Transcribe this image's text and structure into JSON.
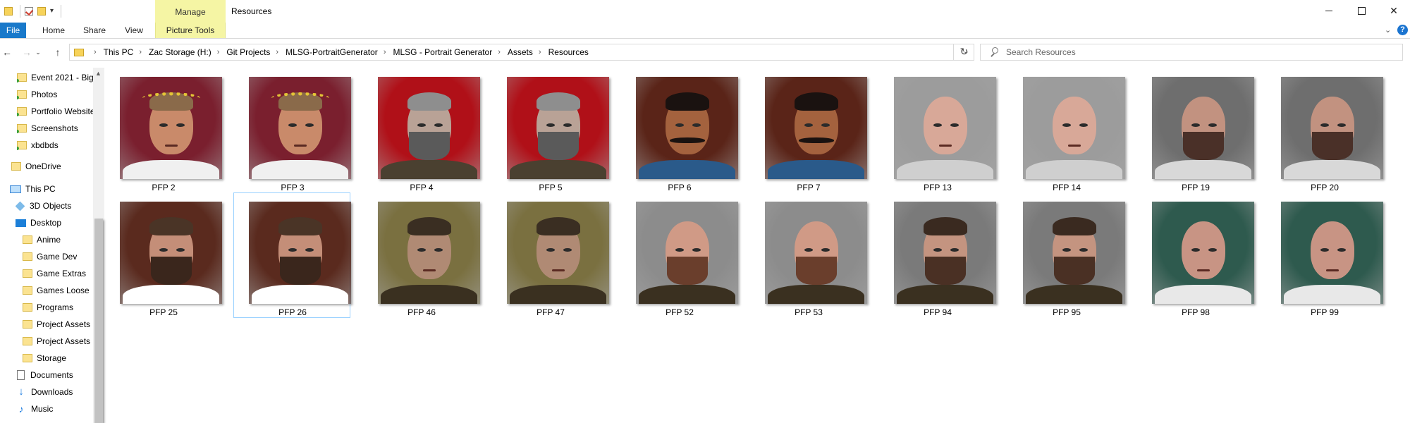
{
  "window": {
    "title": "Resources",
    "context_tab_group": "Manage"
  },
  "ribbon": {
    "tabs": [
      "File",
      "Home",
      "Share",
      "View",
      "Picture Tools"
    ]
  },
  "address": {
    "breadcrumbs": [
      "This PC",
      "Zac Storage (H:)",
      "Git Projects",
      "MLSG-PortraitGenerator",
      "MLSG - Portrait Generator",
      "Assets",
      "Resources"
    ]
  },
  "search": {
    "placeholder": "Search Resources"
  },
  "sidebar": {
    "items": [
      {
        "label": "Event 2021 - Big",
        "icon": "folder-synced-icon"
      },
      {
        "label": "Photos",
        "icon": "folder-synced-icon"
      },
      {
        "label": "Portfolio Website",
        "icon": "folder-synced-icon"
      },
      {
        "label": "Screenshots",
        "icon": "folder-synced-icon"
      },
      {
        "label": "xbdbds",
        "icon": "folder-synced-icon"
      },
      {
        "label": "OneDrive",
        "icon": "folder-icon"
      },
      {
        "label": "This PC",
        "icon": "computer-icon"
      },
      {
        "label": "3D Objects",
        "icon": "cube-icon"
      },
      {
        "label": "Desktop",
        "icon": "desktop-icon"
      },
      {
        "label": "Anime",
        "icon": "folder-icon"
      },
      {
        "label": "Game Dev",
        "icon": "folder-icon"
      },
      {
        "label": "Game Extras",
        "icon": "folder-icon"
      },
      {
        "label": "Games Loose",
        "icon": "folder-icon"
      },
      {
        "label": "Programs",
        "icon": "folder-icon"
      },
      {
        "label": "Project Assets (",
        "icon": "folder-icon"
      },
      {
        "label": "Project Assets (",
        "icon": "folder-icon"
      },
      {
        "label": "Storage",
        "icon": "folder-icon"
      },
      {
        "label": "Documents",
        "icon": "documents-icon"
      },
      {
        "label": "Downloads",
        "icon": "downloads-icon"
      },
      {
        "label": "Music",
        "icon": "music-icon"
      }
    ]
  },
  "files": [
    {
      "name": "PFP 2",
      "bg": "#7a1f2e",
      "skin": "#c98a6a",
      "hair": "#8a6a4a",
      "beard": "",
      "robe": "#f0f0f0",
      "extra": "wreath"
    },
    {
      "name": "PFP 3",
      "bg": "#7a1f2e",
      "skin": "#c98a6a",
      "hair": "#8a6a4a",
      "beard": "",
      "robe": "#f0f0f0",
      "extra": "wreath"
    },
    {
      "name": "PFP 4",
      "bg": "#b01018",
      "skin": "#b9a296",
      "hair": "#8e8e8e",
      "beard": "#5a5a5a",
      "robe": "#4a4030",
      "extra": ""
    },
    {
      "name": "PFP 5",
      "bg": "#b01018",
      "skin": "#b9a296",
      "hair": "#8e8e8e",
      "beard": "#5a5a5a",
      "robe": "#4a4030",
      "extra": ""
    },
    {
      "name": "PFP 6",
      "bg": "#5a2418",
      "skin": "#a4623e",
      "hair": "#1a1210",
      "beard": "",
      "robe": "#2a5a8a",
      "extra": "mustache"
    },
    {
      "name": "PFP 7",
      "bg": "#5a2418",
      "skin": "#a4623e",
      "hair": "#1a1210",
      "beard": "",
      "robe": "#2a5a8a",
      "extra": "mustache"
    },
    {
      "name": "PFP 13",
      "bg": "#9c9c9c",
      "skin": "#d8a898",
      "hair": "",
      "beard": "",
      "robe": "#cfcfcf",
      "extra": ""
    },
    {
      "name": "PFP 14",
      "bg": "#9c9c9c",
      "skin": "#d8a898",
      "hair": "",
      "beard": "",
      "robe": "#cfcfcf",
      "extra": ""
    },
    {
      "name": "PFP 19",
      "bg": "#6e6e6e",
      "skin": "#c29280",
      "hair": "",
      "beard": "#4a3028",
      "robe": "#d8d8d8",
      "extra": ""
    },
    {
      "name": "PFP 20",
      "bg": "#6e6e6e",
      "skin": "#c29280",
      "hair": "",
      "beard": "#4a3028",
      "robe": "#d8d8d8",
      "extra": ""
    },
    {
      "name": "PFP 25",
      "bg": "#5a2a1e",
      "skin": "#c48e78",
      "hair": "#4a3426",
      "beard": "#3a261c",
      "robe": "#ffffff",
      "extra": ""
    },
    {
      "name": "PFP 26",
      "bg": "#5a2a1e",
      "skin": "#c48e78",
      "hair": "#4a3426",
      "beard": "#3a261c",
      "robe": "#ffffff",
      "extra": ""
    },
    {
      "name": "PFP 46",
      "bg": "#7a7040",
      "skin": "#b08a74",
      "hair": "#3a2e22",
      "beard": "",
      "robe": "#3a3020",
      "extra": ""
    },
    {
      "name": "PFP 47",
      "bg": "#7a7040",
      "skin": "#b08a74",
      "hair": "#3a2e22",
      "beard": "",
      "robe": "#3a3020",
      "extra": ""
    },
    {
      "name": "PFP 52",
      "bg": "#8c8c8c",
      "skin": "#d09a86",
      "hair": "",
      "beard": "#6a3e2c",
      "robe": "#3a3020",
      "extra": ""
    },
    {
      "name": "PFP 53",
      "bg": "#8c8c8c",
      "skin": "#d09a86",
      "hair": "",
      "beard": "#6a3e2c",
      "robe": "#3a3020",
      "extra": ""
    },
    {
      "name": "PFP 94",
      "bg": "#7a7a7a",
      "skin": "#c49480",
      "hair": "#3a2a20",
      "beard": "#4a3024",
      "robe": "#3a3020",
      "extra": ""
    },
    {
      "name": "PFP 95",
      "bg": "#7a7a7a",
      "skin": "#c49480",
      "hair": "#3a2a20",
      "beard": "#4a3024",
      "robe": "#3a3020",
      "extra": ""
    },
    {
      "name": "PFP 98",
      "bg": "#2e5a4e",
      "skin": "#c89484",
      "hair": "",
      "beard": "",
      "robe": "#e8e8e8",
      "extra": ""
    },
    {
      "name": "PFP 99",
      "bg": "#2e5a4e",
      "skin": "#c89484",
      "hair": "",
      "beard": "",
      "robe": "#e8e8e8",
      "extra": ""
    }
  ],
  "selected_file": "PFP 26",
  "colors": {
    "accent": "#1979ca",
    "picture_tools": "#f5f5a4",
    "selection_border": "#99d1ff"
  }
}
